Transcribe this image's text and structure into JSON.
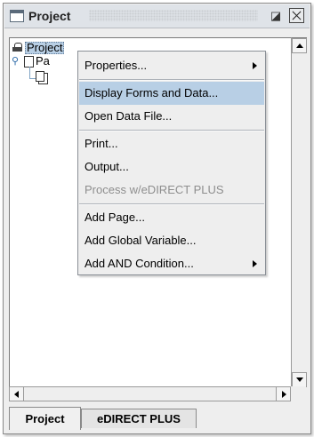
{
  "window": {
    "title": "Project"
  },
  "tree": {
    "root_label": "Project",
    "child_label": "Pa"
  },
  "context_menu": {
    "items": [
      {
        "label": "Properties...",
        "submenu": true
      },
      {
        "label": "Display Forms and Data...",
        "highlighted": true
      },
      {
        "label": "Open Data File..."
      },
      {
        "label": "Print..."
      },
      {
        "label": "Output..."
      },
      {
        "label": "Process w/eDIRECT PLUS",
        "disabled": true
      },
      {
        "label": "Add Page..."
      },
      {
        "label": "Add Global Variable..."
      },
      {
        "label": "Add AND Condition...",
        "submenu": true
      }
    ]
  },
  "tabs": [
    {
      "label": "Project",
      "active": true
    },
    {
      "label": "eDIRECT PLUS",
      "active": false
    }
  ],
  "colors": {
    "selection": "#b8cfe5",
    "background": "#eeeeee",
    "tree_background": "#ffffff",
    "disabled_text": "#8e8e8e"
  },
  "icons": {
    "window": "window-icon",
    "maximize": "maximize-icon",
    "close": "close-icon",
    "project": "project-icon",
    "page": "page-icon",
    "form": "form-icon"
  }
}
